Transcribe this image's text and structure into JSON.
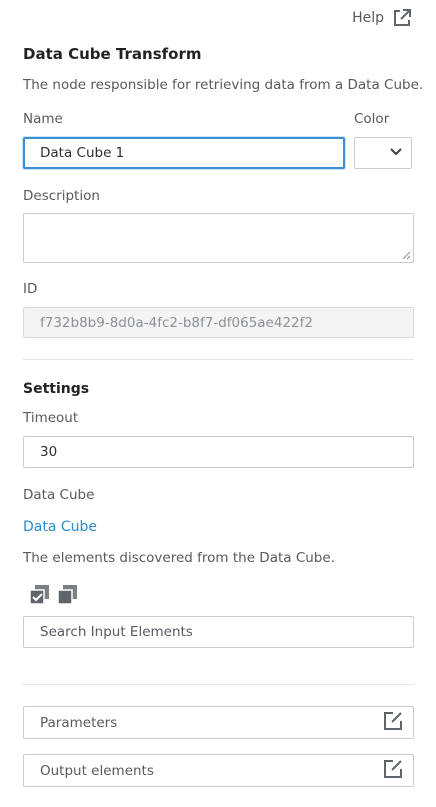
{
  "header": {
    "help_label": "Help"
  },
  "node": {
    "title": "Data Cube Transform",
    "description": "The node responsible for retrieving data from a Data Cube."
  },
  "fields": {
    "name_label": "Name",
    "name_value": "Data Cube 1",
    "color_label": "Color",
    "description_label": "Description",
    "description_value": "",
    "id_label": "ID",
    "id_value": "f732b8b9-8d0a-4fc2-b8f7-df065ae422f2"
  },
  "settings": {
    "heading": "Settings",
    "timeout_label": "Timeout",
    "timeout_value": "30",
    "data_cube_label": "Data Cube",
    "data_cube_link": "Data Cube",
    "elements_hint": "The elements discovered from the Data Cube.",
    "search_placeholder": "Search Input Elements"
  },
  "sections": {
    "parameters_label": "Parameters",
    "output_elements_label": "Output elements"
  }
}
